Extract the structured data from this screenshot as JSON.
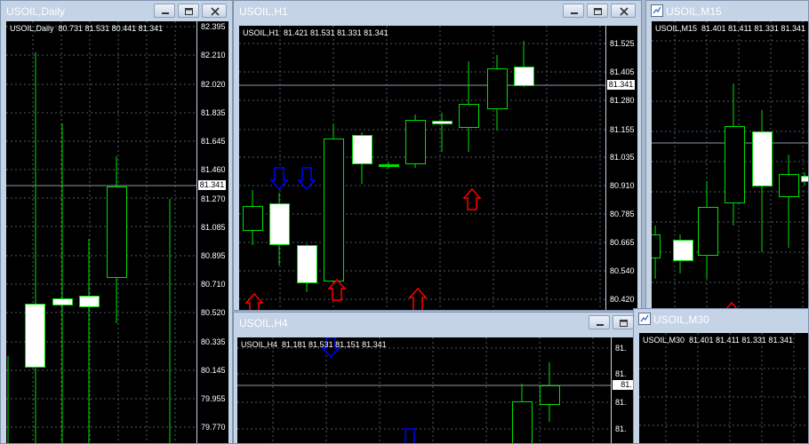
{
  "windows": {
    "daily": {
      "title": "USOIL,Daily",
      "info": "USOIL,Daily  80.731 81.531 80.441 81.341",
      "price_tag": "81.341",
      "ticks": [
        "82.395",
        "82.210",
        "82.020",
        "81.835",
        "81.645",
        "81.460",
        "81.270",
        "81.085",
        "80.895",
        "80.710",
        "80.520",
        "80.335",
        "80.145",
        "79.955",
        "79.770"
      ]
    },
    "h1": {
      "title": "USOIL,H1",
      "info": "USOIL,H1  81.421 81.531 81.331 81.341",
      "price_tag": "81.341",
      "ticks": [
        "81.525",
        "81.405",
        "81.280",
        "81.155",
        "81.035",
        "80.910",
        "80.785",
        "80.665",
        "80.540",
        "80.420"
      ]
    },
    "m15": {
      "title": "USOIL,M15",
      "info": "USOIL,M15  81.401 81.411 81.331 81.341"
    },
    "h4": {
      "title": "USOIL,H4",
      "info": "USOIL,H4  81.181 81.531 81.151 81.341",
      "price_tag": "81.",
      "ticks": [
        "81.",
        "81.",
        "81.",
        "81."
      ]
    },
    "m30": {
      "title": "USOIL,M30",
      "info": "USOIL,M30  81.401 81.411 81.331 81.341"
    }
  },
  "buttons": {
    "minimize_icon": "minimize-icon",
    "restore_icon": "restore-icon",
    "close_icon": "close-icon"
  },
  "colors": {
    "chart_bg": "#000000",
    "candle_wick": "#00ff00",
    "bull_body": "#000000",
    "bear_body": "#ffffff",
    "buy_arrow": "#0000ff",
    "sell_arrow": "#ff0000",
    "grid": "#4a5a6a",
    "title_text": "#ffffff",
    "frame": "#c4d3e6"
  }
}
